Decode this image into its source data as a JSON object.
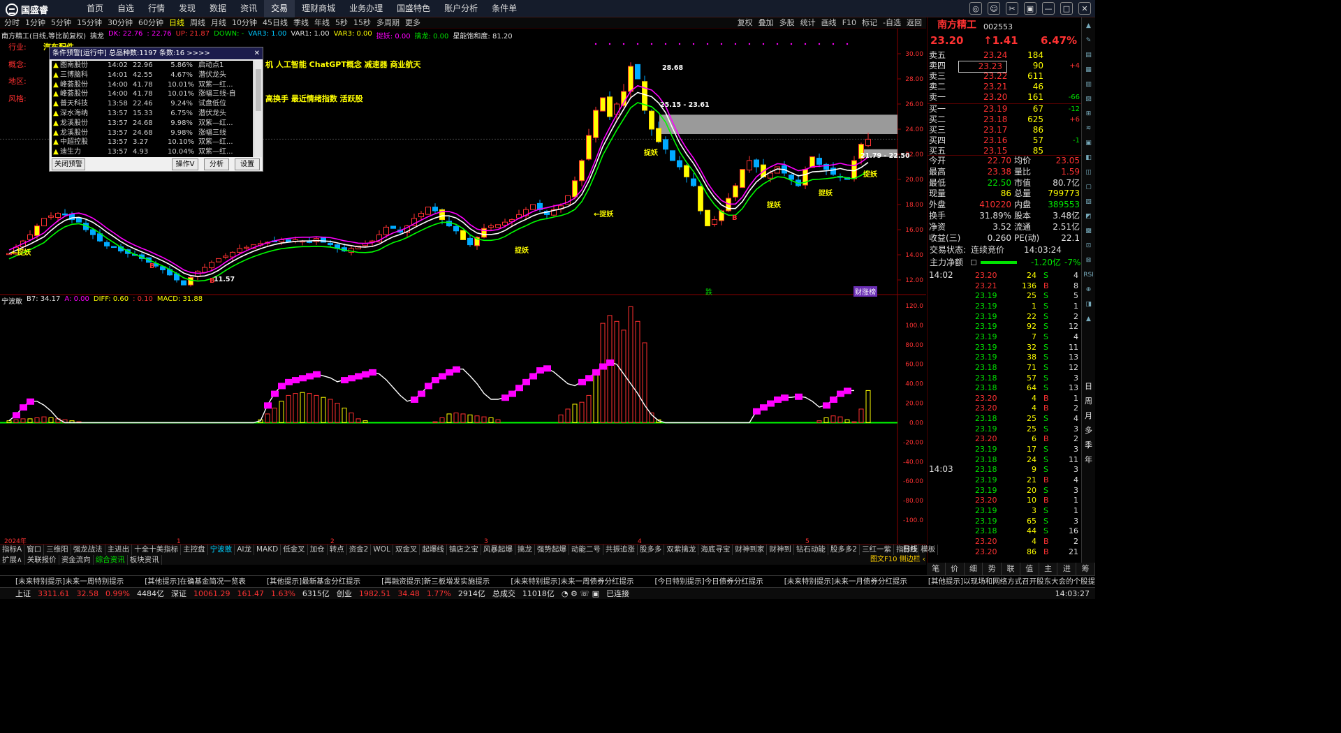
{
  "app": {
    "logo": "国盛睿",
    "menu": [
      "首页",
      "自选",
      "行情",
      "发现",
      "数据",
      "资讯",
      "交易",
      "理财商城",
      "业务办理",
      "国盛特色",
      "账户分析",
      "条件单"
    ],
    "active_menu": "交易"
  },
  "periods": {
    "items": [
      "分时",
      "1分钟",
      "5分钟",
      "15分钟",
      "30分钟",
      "60分钟",
      "日线",
      "周线",
      "月线",
      "10分钟",
      "45日线",
      "季线",
      "年线",
      "5秒",
      "15秒",
      "多周期",
      "更多"
    ],
    "selected": "日线"
  },
  "tools": [
    "复权",
    "叠加",
    "多股",
    "统计",
    "画线",
    "F10",
    "标记",
    "-自选",
    "返回"
  ],
  "main_info": {
    "title": "南方精工(日线,等比前复权)",
    "indicator": "擒龙",
    "dk": "DK: 22.76",
    "dk2": ": 22.76",
    "up": "UP: 21.87",
    "down": "DOWN: -",
    "var3a": "VAR3: 1.00",
    "var1": "VAR1: 1.00",
    "var3b": "VAR3: 0.00",
    "zy": "捉妖: 0.00",
    "ql": "擒龙: 0.00",
    "bh": "星能饱和度: 81.20"
  },
  "side": {
    "hy_label": "行业:",
    "hy_value": "汽车配件",
    "gn_label": "概念:",
    "gn_value": "机 人工智能 ChatGPT概念 减速器 商业航天",
    "dq_label": "地区:",
    "fg_label": "风格:",
    "fg_value": "高换手 最近情绪指数 活跃股"
  },
  "chart_labels": {
    "zy": "捉妖",
    "high": "28.68",
    "band1": "25.15 - 23.61",
    "band2": "21.79 - 22.50",
    "low": "11.57",
    "b": "B",
    "die": "跌",
    "cai": "财涨榜"
  },
  "sub_info": {
    "title": "宁波敢",
    "b7": "B7: 34.17",
    "a": "A: 0.00",
    "diff": "DIFF: 0.60",
    "zero": ": 0.10",
    "macd": "MACD: 31.88"
  },
  "chart_data": {
    "type": "candlestick",
    "title": "南方精工(日线,等比前复权)",
    "y_ticks_main": [
      "30.00",
      "28.00",
      "26.00",
      "24.00",
      "22.00",
      "20.00",
      "18.00",
      "16.00",
      "14.00",
      "12.00"
    ],
    "ylim_main": [
      11,
      31
    ],
    "y_ticks_sub": [
      "120.0",
      "100.0",
      "80.00",
      "60.00",
      "40.00",
      "20.00",
      "0.00",
      "-20.00",
      "-40.00",
      "-60.00",
      "-80.00",
      "-100.0"
    ],
    "ylim_sub": [
      -120,
      125
    ],
    "x_ticks": [
      "2024年",
      "1",
      "2",
      "3",
      "4",
      "5"
    ],
    "x_tick_index": [
      0,
      24,
      46,
      68,
      90,
      114
    ],
    "close": [
      14.1,
      14.6,
      15.1,
      15.6,
      16.3,
      16.9,
      17.1,
      17.3,
      17.2,
      16.8,
      16.6,
      16.0,
      15.6,
      15.1,
      14.7,
      14.6,
      14.3,
      14.1,
      14.0,
      13.7,
      13.4,
      13.1,
      12.8,
      12.4,
      12.0,
      11.6,
      12.2,
      12.7,
      13.0,
      13.4,
      13.7,
      13.9,
      14.2,
      14.5,
      14.6,
      14.8,
      14.9,
      15.0,
      15.1,
      15.2,
      15.0,
      15.2,
      15.1,
      15.0,
      15.3,
      15.0,
      14.8,
      14.5,
      14.3,
      14.5,
      14.7,
      14.9,
      15.1,
      15.6,
      16.2,
      16.1,
      15.8,
      16.3,
      16.9,
      17.3,
      17.8,
      17.5,
      16.8,
      16.3,
      15.9,
      15.2,
      14.8,
      15.4,
      16.1,
      16.3,
      16.4,
      16.6,
      16.8,
      17.2,
      17.6,
      18.0,
      17.6,
      17.2,
      17.6,
      17.9,
      18.7,
      19.9,
      21.5,
      23.5,
      25.5,
      26.5,
      25.0,
      26.0,
      27.0,
      29.0,
      28.0,
      25.5,
      24.0,
      23.0,
      22.4,
      21.5,
      21.0,
      20.2,
      19.5,
      17.5,
      16.3,
      16.8,
      17.5,
      18.5,
      19.5,
      20.8,
      21.5,
      21.0,
      20.2,
      20.5,
      21.0,
      20.5,
      20.0,
      19.5,
      20.8,
      21.8,
      21.2,
      20.8,
      20.4,
      20.2,
      20.0,
      21.5,
      22.8,
      23.2
    ],
    "sub_bars": [
      2,
      3,
      4,
      4,
      5,
      6,
      5,
      4,
      3,
      2,
      1,
      0,
      0,
      0,
      0,
      0,
      0,
      0,
      0,
      0,
      0,
      0,
      0,
      0,
      0,
      0,
      0,
      0,
      0,
      0,
      0,
      0,
      0,
      0,
      0,
      0,
      3,
      9,
      15,
      22,
      28,
      30,
      31,
      30,
      28,
      26,
      24,
      20,
      15,
      10,
      4,
      2,
      0,
      0,
      0,
      0,
      0,
      0,
      0,
      0,
      0,
      1,
      5,
      9,
      10,
      9,
      8,
      7,
      6,
      5,
      3,
      0,
      0,
      0,
      0,
      0,
      0,
      0,
      0,
      8,
      14,
      19,
      21,
      28,
      52,
      102,
      110,
      104,
      95,
      119,
      104,
      82,
      10,
      3,
      0,
      0,
      0,
      0,
      0,
      0,
      0,
      0,
      0,
      0,
      0,
      0,
      0,
      0,
      0,
      0,
      0,
      0,
      0,
      0,
      0,
      0,
      2,
      5,
      7,
      6,
      3,
      1,
      14,
      33
    ],
    "sub_line": [
      2,
      8,
      16,
      22,
      22,
      18,
      12,
      4,
      0,
      0,
      0,
      0,
      0,
      0,
      0,
      0,
      0,
      0,
      0,
      0,
      0,
      0,
      0,
      0,
      0,
      0,
      0,
      0,
      0,
      0,
      0,
      0,
      0,
      0,
      0,
      0,
      2,
      18,
      30,
      38,
      42,
      44,
      46,
      48,
      50,
      48,
      46,
      42,
      44,
      46,
      48,
      50,
      52,
      50,
      44,
      36,
      28,
      22,
      24,
      30,
      38,
      44,
      48,
      52,
      55,
      55,
      48,
      40,
      30,
      24,
      24,
      26,
      30,
      36,
      42,
      48,
      54,
      56,
      52,
      46,
      40,
      38,
      42,
      46,
      52,
      58,
      62,
      60,
      50,
      40,
      30,
      18,
      8,
      2,
      0,
      0,
      0,
      0,
      0,
      0,
      0,
      0,
      0,
      0,
      0,
      0,
      0,
      12,
      16,
      20,
      24,
      26,
      26,
      27,
      26,
      22,
      16,
      18,
      24,
      30,
      33,
      33
    ],
    "series": [
      {
        "name": "DK",
        "color": "#ffffff"
      },
      {
        "name": "UP",
        "color": "#ff00ff"
      },
      {
        "name": "DOWN",
        "color": "#00ff00"
      }
    ]
  },
  "popup": {
    "title": "条件预警[运行中] 总品种数:1197 条数:16  >>>>",
    "rows": [
      [
        "▲",
        "图南股份",
        "14:02",
        "22.96",
        "5.86%",
        "启动点1"
      ],
      [
        "▲",
        "三博脑科",
        "14:01",
        "42.55",
        "4.67%",
        "潜伏龙头"
      ],
      [
        "▲",
        "峰荟股份",
        "14:00",
        "41.78",
        "10.01%",
        "双紫—红..."
      ],
      [
        "▲",
        "峰荟股份",
        "14:00",
        "41.78",
        "10.01%",
        "涨幅三线-自"
      ],
      [
        "▲",
        "普天科技",
        "13:58",
        "22.46",
        "9.24%",
        "试盘低位"
      ],
      [
        "▲",
        "深水海纳",
        "13:57",
        "15.33",
        "6.75%",
        "潜伏龙头"
      ],
      [
        "▲",
        "龙溪股份",
        "13:57",
        "24.68",
        "9.98%",
        "双紫—红..."
      ],
      [
        "▲",
        "龙溪股份",
        "13:57",
        "24.68",
        "9.98%",
        "涨幅三线"
      ],
      [
        "▲",
        "中超控股",
        "13:57",
        "3.27",
        "10.10%",
        "双紫—红..."
      ],
      [
        "▲",
        "迪生力",
        "13:57",
        "4.93",
        "10.04%",
        "双紫—红..."
      ]
    ],
    "btn_close": "关闭预警",
    "btn_op": "操作V",
    "btn_an": "分析",
    "btn_set": "设置"
  },
  "rp": {
    "name": "南方精工",
    "code": "002553",
    "price": "23.20",
    "chg": "↑1.41",
    "pct": "6.47%",
    "sells": [
      [
        "卖五",
        "23.24",
        "184",
        ""
      ],
      [
        "卖四",
        "23.23",
        "90",
        "+4"
      ],
      [
        "卖三",
        "23.22",
        "611",
        ""
      ],
      [
        "卖二",
        "23.21",
        "46",
        ""
      ],
      [
        "卖一",
        "23.20",
        "161",
        "-66"
      ]
    ],
    "buys": [
      [
        "买一",
        "23.19",
        "67",
        "-12"
      ],
      [
        "买二",
        "23.18",
        "625",
        "+6"
      ],
      [
        "买三",
        "23.17",
        "86",
        ""
      ],
      [
        "买四",
        "23.16",
        "57",
        "-1"
      ],
      [
        "买五",
        "23.15",
        "85",
        ""
      ]
    ],
    "stats": [
      [
        "今开",
        "22.70",
        "均价",
        "23.05"
      ],
      [
        "最高",
        "23.38",
        "量比",
        "1.59"
      ],
      [
        "最低",
        "22.50",
        "市值",
        "80.7亿"
      ],
      [
        "现量",
        "86",
        "总量",
        "799773"
      ],
      [
        "外盘",
        "410220",
        "内盘",
        "389553"
      ],
      [
        "换手",
        "31.89%",
        "股本",
        "3.48亿"
      ],
      [
        "净资",
        "3.52",
        "流通",
        "2.51亿"
      ],
      [
        "收益(三)",
        "0.260",
        "PE(动)",
        "22.1"
      ]
    ],
    "status_label": "交易状态:",
    "status_value": "连续竞价",
    "status_time": "14:03:24",
    "zl_label": "主力净额",
    "zl_value": "-1.20亿",
    "zl_pct": "-7%",
    "t1": "14:02",
    "t2": "14:03",
    "ticks": [
      [
        "23.20",
        "24",
        "S",
        "4"
      ],
      [
        "23.21",
        "136",
        "B",
        "8"
      ],
      [
        "23.19",
        "25",
        "S",
        "5"
      ],
      [
        "23.19",
        "1",
        "S",
        "1"
      ],
      [
        "23.19",
        "22",
        "S",
        "2"
      ],
      [
        "23.19",
        "92",
        "S",
        "12"
      ],
      [
        "23.19",
        "7",
        "S",
        "4"
      ],
      [
        "23.19",
        "32",
        "S",
        "11"
      ],
      [
        "23.19",
        "38",
        "S",
        "13"
      ],
      [
        "23.18",
        "71",
        "S",
        "12"
      ],
      [
        "23.18",
        "57",
        "S",
        "3"
      ],
      [
        "23.18",
        "64",
        "S",
        "13"
      ],
      [
        "23.20",
        "4",
        "B",
        "1"
      ],
      [
        "23.20",
        "4",
        "B",
        "2"
      ],
      [
        "23.18",
        "25",
        "S",
        "4"
      ],
      [
        "23.19",
        "25",
        "S",
        "3"
      ],
      [
        "23.20",
        "6",
        "B",
        "2"
      ],
      [
        "23.19",
        "17",
        "S",
        "3"
      ],
      [
        "23.18",
        "24",
        "S",
        "11"
      ],
      [
        "23.18",
        "9",
        "S",
        "3"
      ],
      [
        "23.19",
        "21",
        "B",
        "4"
      ],
      [
        "23.19",
        "20",
        "S",
        "3"
      ],
      [
        "23.20",
        "10",
        "B",
        "1"
      ],
      [
        "23.19",
        "3",
        "S",
        "1"
      ],
      [
        "23.19",
        "65",
        "S",
        "3"
      ],
      [
        "23.18",
        "44",
        "S",
        "16"
      ],
      [
        "23.20",
        "4",
        "B",
        "2"
      ],
      [
        "23.20",
        "86",
        "B",
        "21"
      ]
    ]
  },
  "rstrip": [
    "日",
    "周",
    "月",
    "多",
    "季",
    "年"
  ],
  "tabs1": [
    "指标A",
    "窗口",
    "三维阳",
    "强龙战法",
    "主进出",
    "十全十美指标",
    "主控盘",
    "宁波敢",
    "AI龙",
    "MAKD",
    "低金叉",
    "加仓",
    "转点",
    "资金2",
    "WOL",
    "双金叉",
    "起爆线",
    "镇店之宝",
    "风暴起爆",
    "擒龙",
    "强势起爆",
    "动能二号",
    "共振追涨",
    "股多多",
    "双紫擒龙",
    "海底寻宝",
    "财神到家",
    "财神到",
    "钻石动能",
    "股多多2",
    "三红一紫",
    "指标B",
    "模板"
  ],
  "tabs1_sel": "宁波敢",
  "tabs2": [
    "扩展∧",
    "关联报价",
    "资金流向",
    "综合资讯",
    "板块资讯"
  ],
  "tabs2_sel": "综合资讯",
  "rtabs": [
    "笔",
    "价",
    "细",
    "势",
    "联",
    "值",
    "主",
    "进",
    "筹"
  ],
  "right_label": "日线",
  "f10": "图文F10 侧边栏 ‹",
  "news": [
    "[未来特别提示]未来一周特别提示",
    "[其他提示]在确基金简况一览表",
    "[其他提示]最新基金分红提示",
    "[再融资提示]新三板增发实施提示",
    "[未来特别提示]未来一周债券分红提示",
    "[今日特别提示]今日债券分红提示",
    "[未来特别提示]未来一月债券分红提示",
    "[其他提示]以现场和网络方式召开股东大会的个股提示"
  ],
  "status": {
    "sh_l": "上证",
    "sh_v": "3311.61",
    "sh_c": "32.58",
    "sh_p": "0.99%",
    "sh_a": "4484亿",
    "sz_l": "深证",
    "sz_v": "10061.29",
    "sz_c": "161.47",
    "sz_p": "1.63%",
    "sz_a": "6315亿",
    "cy_l": "创业",
    "cy_v": "1982.51",
    "cy_c": "34.48",
    "cy_p": "1.77%",
    "cy_a": "2914亿",
    "vol_l": "总成交",
    "vol_v": "11018亿",
    "conn": "已连接",
    "time": "14:03:27"
  },
  "colors": {
    "up": "#ff3232",
    "down": "#00e400",
    "bg": "#000000",
    "yellow": "#ffff00",
    "magenta": "#ff00ff"
  }
}
